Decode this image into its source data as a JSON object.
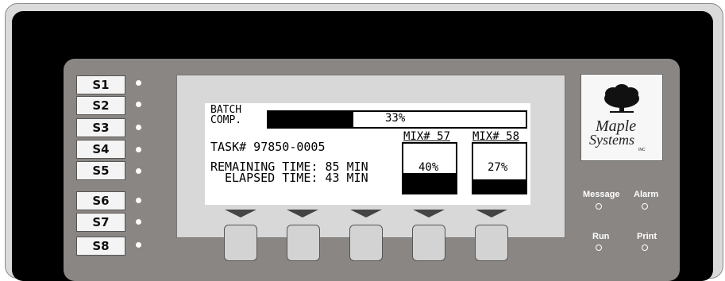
{
  "soft_keys": [
    "S1",
    "S2",
    "S3",
    "S4",
    "S5",
    "S6",
    "S7",
    "S8"
  ],
  "display": {
    "batch_label_1": "BATCH",
    "batch_label_2": "COMP.",
    "batch_percent_text": "33%",
    "batch_percent": 0.33,
    "task": "TASK# 97850-0005",
    "remaining": "REMAINING TIME: 85 MIN",
    "elapsed": "ELAPSED TIME: 43 MIN",
    "mix1": {
      "label": "MIX# 57",
      "value_text": "40%",
      "value": 0.4
    },
    "mix2": {
      "label": "MIX# 58",
      "value_text": "27%",
      "value": 0.27
    }
  },
  "logo": {
    "line1": "Maple",
    "line2": "Systems",
    "suffix": "INC"
  },
  "indicators": {
    "message": "Message",
    "alarm": "Alarm",
    "run": "Run",
    "print": "Print"
  },
  "colors": {
    "panel": "#8a8683",
    "bezel": "#000000",
    "lcd_bg": "#ffffff"
  }
}
